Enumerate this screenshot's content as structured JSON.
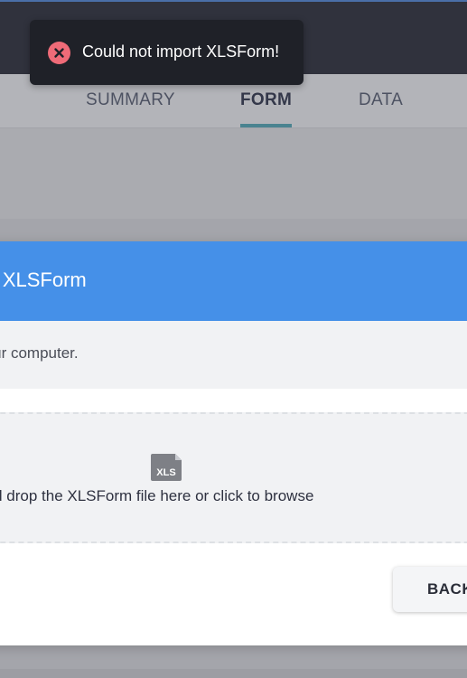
{
  "toast": {
    "message": "Could not import XLSForm!",
    "icon": "error-icon",
    "icon_color": "#ef6b78"
  },
  "tabs": [
    {
      "label": "SUMMARY",
      "active": false
    },
    {
      "label": "FORM",
      "active": true
    },
    {
      "label": "DATA",
      "active": false
    }
  ],
  "modal": {
    "title": "oad XLSForm",
    "subtext": "n your computer.",
    "dropzone": {
      "icon": "xls-file-icon",
      "icon_label": "XLS",
      "text": "g and drop the XLSForm file here or click to browse"
    },
    "back_label": "BACK",
    "header_color": "#4590e8"
  }
}
